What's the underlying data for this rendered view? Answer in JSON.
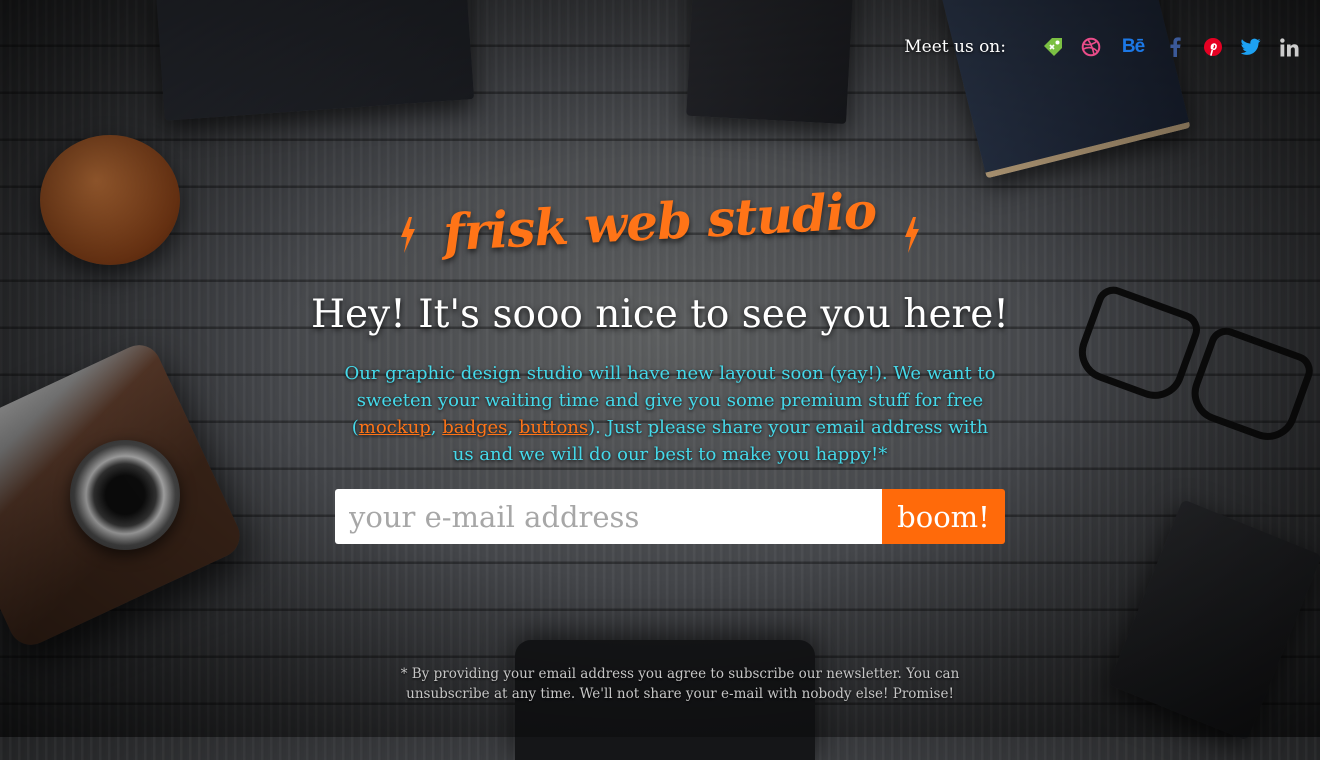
{
  "header": {
    "meet_label": "Meet us on:",
    "social": [
      {
        "name": "tag-icon",
        "color": "#7bc043"
      },
      {
        "name": "dribbble-icon",
        "color": "#ea4c89"
      },
      {
        "name": "behance-icon",
        "text": "Bē",
        "color": "#1c78e6"
      },
      {
        "name": "facebook-icon",
        "color": "#3b5998"
      },
      {
        "name": "pinterest-icon",
        "color": "#e60023"
      },
      {
        "name": "twitter-icon",
        "color": "#1da1f2"
      },
      {
        "name": "linkedin-icon",
        "color": "#cccccc"
      }
    ]
  },
  "hero": {
    "logo": "frisk web studio",
    "headline": "Hey! It's sooo nice to see you here!",
    "intro_part1": "Our graphic design studio will have new layout soon (yay!). We want to sweeten your waiting time and give you some premium stuff for free (",
    "link_mockup": "mockup",
    "sep1": ", ",
    "link_badges": "badges",
    "sep2": ", ",
    "link_buttons": "buttons",
    "intro_part2": "). Just please share your email address with us and we will do our best to make you happy!*"
  },
  "form": {
    "email_placeholder": "your e-mail address",
    "email_value": "",
    "submit_label": "boom!"
  },
  "footer": {
    "disclaimer": "* By providing your email address you agree to subscribe our newsletter. You can unsubscribe at any time. We'll not share your e-mail with nobody else! Promise!"
  },
  "colors": {
    "accent": "#ff6a0a",
    "logo": "#ff7417",
    "intro_text": "#45d9ea"
  }
}
